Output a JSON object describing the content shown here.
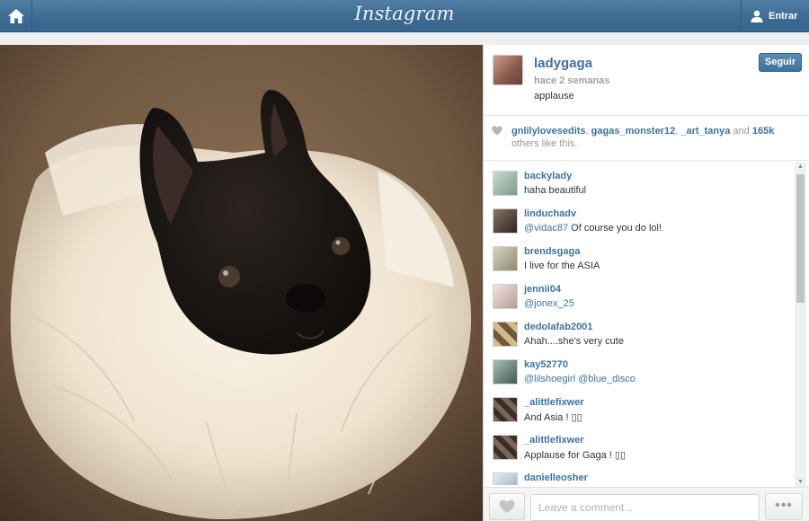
{
  "topbar": {
    "logo": "Instagram",
    "login_label": "Entrar",
    "home_icon": "home-icon",
    "user_icon": "user-icon"
  },
  "photo": {
    "description_icon": "dog-in-tutu-photo"
  },
  "post": {
    "username": "ladygaga",
    "time": "hace 2 semanas",
    "caption": "applause",
    "follow_label": "Seguir"
  },
  "likes": {
    "users": [
      "gnlilylovesedits",
      "gagas_monster12",
      "_art_tanya"
    ],
    "sep1": ", ",
    "sep2": ", ",
    "and": " and ",
    "count": "165k",
    "suffix": " others like this."
  },
  "comments": [
    {
      "user": "backylady",
      "mention": "",
      "text": "haha beautiful",
      "avatar": "#a7c4b8"
    },
    {
      "user": "linduchadv",
      "mention": "@vidac87",
      "text": " Of course you do lol!",
      "avatar": "#55463d"
    },
    {
      "user": "brendsgaga",
      "mention": "",
      "text": "I live for the ASIA",
      "avatar": "#b7b39a"
    },
    {
      "user": "jennii04",
      "mention": "@jonex_25",
      "text": "",
      "avatar": "#d8c8c4"
    },
    {
      "user": "dedolafab2001",
      "mention": "",
      "text": "Ahah....she's very cute",
      "avatar": "#b49a6a"
    },
    {
      "user": "kay52770",
      "mention": "@lilshoegirl @blue_disco",
      "text": "",
      "avatar": "#6c8a7c"
    },
    {
      "user": "_alittlefixwer",
      "mention": "",
      "text": "And Asia ! ▯▯",
      "avatar": "#5a4a40"
    },
    {
      "user": "_alittlefixwer",
      "mention": "",
      "text": "Applause for Gaga ! ▯▯",
      "avatar": "#5a4a40"
    },
    {
      "user": "danielleosher",
      "mention": "",
      "text": "",
      "avatar": "#c9d3dc"
    }
  ],
  "footer": {
    "comment_placeholder": "Leave a comment...",
    "more_label": "•••"
  },
  "colors": {
    "brand": "#3f729b",
    "topbar": "#3d6a92"
  }
}
